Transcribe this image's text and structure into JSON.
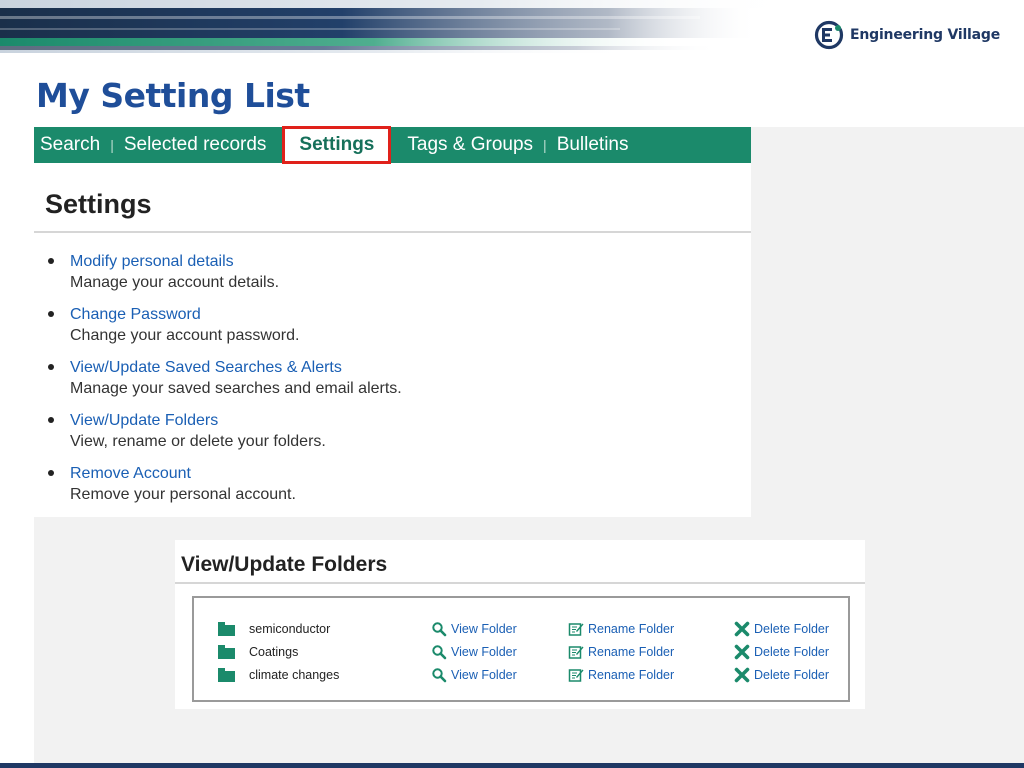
{
  "brand": {
    "name": "Engineering Village",
    "logo_letter": "E",
    "banner_dark": "#1a2f4a",
    "banner_green": "#1b8a6b",
    "bottom_bar": "#1f3864"
  },
  "slide": {
    "title": "My Setting List",
    "title_color": "#1f4e99"
  },
  "nav": {
    "tabs": [
      {
        "label": "Search",
        "active": false
      },
      {
        "label": "Selected records",
        "active": false
      },
      {
        "label": "Settings",
        "active": true
      },
      {
        "label": "Tags & Groups",
        "active": false
      },
      {
        "label": "Bulletins",
        "active": false
      }
    ],
    "separator": "|",
    "bar_color": "#1b8a6b",
    "highlight_color": "#e0211a"
  },
  "settings": {
    "heading": "Settings",
    "items": [
      {
        "link": "Modify personal details",
        "desc": "Manage your account details."
      },
      {
        "link": "Change Password",
        "desc": "Change your account password."
      },
      {
        "link": "View/Update Saved Searches & Alerts",
        "desc": "Manage your saved searches and email alerts."
      },
      {
        "link": "View/Update Folders",
        "desc": "View, rename or delete your folders."
      },
      {
        "link": "Remove Account",
        "desc": "Remove your personal account."
      }
    ]
  },
  "folders": {
    "heading": "View/Update Folders",
    "rows": [
      {
        "name": "semiconductor",
        "view": "View Folder",
        "rename": "Rename Folder",
        "delete": "Delete Folder"
      },
      {
        "name": "Coatings",
        "view": "View Folder",
        "rename": "Rename Folder",
        "delete": "Delete Folder"
      },
      {
        "name": "climate changes",
        "view": "View Folder",
        "rename": "Rename Folder",
        "delete": "Delete Folder"
      }
    ],
    "icons": {
      "folder": "folder-icon",
      "view": "magnifier-icon",
      "rename": "edit-icon",
      "delete": "delete-x-icon"
    }
  }
}
